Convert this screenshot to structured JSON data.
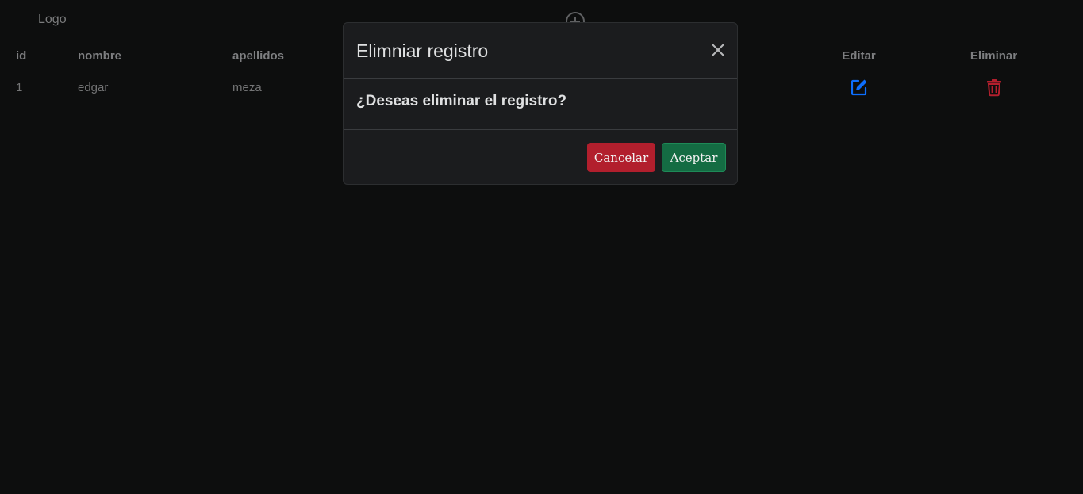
{
  "header": {
    "logo": "Logo",
    "add_icon": "plus-circle-icon"
  },
  "table": {
    "columns": [
      "id",
      "nombre",
      "apellidos",
      "",
      "Editar",
      "Eliminar"
    ],
    "rows": [
      {
        "id": "1",
        "nombre": "edgar",
        "apellidos": "meza"
      }
    ],
    "edit_icon": "edit-icon",
    "delete_icon": "trash-icon"
  },
  "modal": {
    "title": "Elimniar registro",
    "question": "¿Deseas eliminar el registro?",
    "cancel_label": "Cancelar",
    "accept_label": "Aceptar"
  },
  "colors": {
    "background": "#0d0e0e",
    "modal_background": "#1b1c1e",
    "edit_icon": "#0d6efd",
    "delete_icon": "#b21f2d",
    "cancel_button": "#b21f2d",
    "accept_button": "#146c43"
  }
}
